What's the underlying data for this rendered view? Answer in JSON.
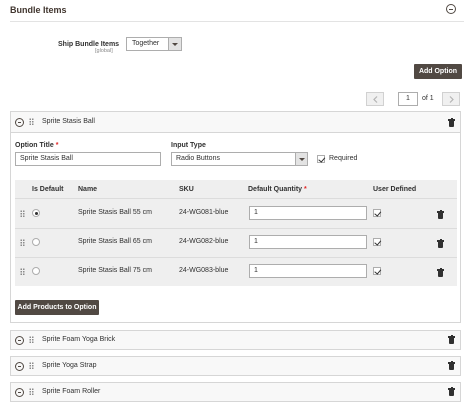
{
  "section": {
    "title": "Bundle Items"
  },
  "ship": {
    "label": "Ship Bundle Items",
    "scope": "[global]",
    "value": "Together"
  },
  "toolbar": {
    "add_option_label": "Add Option"
  },
  "pager": {
    "current_page": "1",
    "of_label": "of 1"
  },
  "option_expanded": {
    "title": "Sprite Stasis Ball",
    "option_title_label": "Option Title",
    "option_title_value": "Sprite Stasis Ball",
    "input_type_label": "Input Type",
    "input_type_value": "Radio Buttons",
    "required_label": "Required",
    "columns": {
      "is_default": "Is Default",
      "name": "Name",
      "sku": "SKU",
      "qty": "Default Quantity",
      "user_defined": "User Defined"
    },
    "rows": [
      {
        "name": "Sprite Stasis Ball 55 cm",
        "sku": "24-WG081-blue",
        "qty": "1"
      },
      {
        "name": "Sprite Stasis Ball 65 cm",
        "sku": "24-WG082-blue",
        "qty": "1"
      },
      {
        "name": "Sprite Stasis Ball 75 cm",
        "sku": "24-WG083-blue",
        "qty": "1"
      }
    ],
    "add_products_label": "Add Products to Option"
  },
  "collapsed_options": [
    {
      "title": "Sprite Foam Yoga Brick"
    },
    {
      "title": "Sprite Yoga Strap"
    },
    {
      "title": "Sprite Foam Roller"
    }
  ],
  "colors": {
    "button_dark": "#514943",
    "required_star": "#e22626",
    "panel_border": "#d6d6d6"
  },
  "icons": [
    "collapse-icon",
    "drag-handle-icon",
    "trash-icon",
    "chevron-left-icon",
    "chevron-right-icon",
    "chevron-down-icon",
    "checkbox-check-icon"
  ]
}
